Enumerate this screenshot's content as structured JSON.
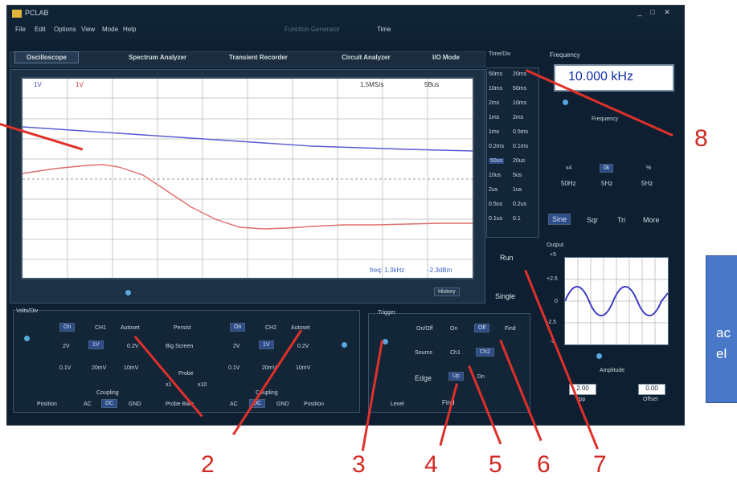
{
  "app": {
    "title": "PCLAB",
    "window_controls": [
      "_",
      "□",
      "✕"
    ],
    "menu": [
      "File",
      "Edit",
      "Options",
      "View",
      "Mode",
      "Help"
    ],
    "menu_right": [
      "Function Generator",
      "Time"
    ]
  },
  "tabs": [
    "Oscilloscope",
    "Spectrum Analyzer",
    "Transient Recorder",
    "Circuit Analyzer",
    "I/O Mode"
  ],
  "scope": {
    "header_left": "1V",
    "header_ch2": "1V",
    "header_rate": "1.5MS/s",
    "header_time": "5Bus",
    "footer_freq": "freq: 1.3kHz",
    "footer_db": "-2.3dBm",
    "history_label": "History",
    "colors": {
      "ch1": "#5a5ad6",
      "ch2": "#e26c6c",
      "grid": "#c9c9c9"
    }
  },
  "timebase": {
    "label": "Time/Div",
    "rows": [
      [
        "50ms",
        "20ms"
      ],
      [
        "10ms",
        "50ms"
      ],
      [
        "2ms",
        "10ms"
      ],
      [
        "1ms",
        "2ms"
      ],
      [
        "1ms",
        "0.5ms"
      ],
      [
        "0.2ms",
        "0.1ms"
      ],
      [
        "50us",
        "20us"
      ],
      [
        "10us",
        "5us"
      ],
      [
        "2us",
        "1us"
      ],
      [
        "0.5us",
        "0.2us"
      ],
      [
        "0.1us",
        "0.1"
      ]
    ],
    "run": "Run",
    "single": "Single"
  },
  "volts": {
    "label": "Volts/Div",
    "ch1": {
      "on": "On",
      "name": "CH1",
      "auto": "Autoset",
      "values": [
        "2V",
        "1V",
        "0.2V",
        "0.1V",
        "20mV",
        "10mV"
      ],
      "coupling": "Coupling",
      "coupling_opts": [
        "AC",
        "DC",
        "GND"
      ],
      "position": "Position"
    },
    "ch2": {
      "on": "On",
      "name": "CH2",
      "auto": "Autoset",
      "values": [
        "2V",
        "1V",
        "0.2V",
        "0.1V",
        "20mV",
        "10mV"
      ],
      "coupling": "Coupling",
      "coupling_opts": [
        "AC",
        "DC",
        "GND"
      ],
      "position": "Position"
    },
    "persist": "Persist",
    "big_screen": "Big Screen",
    "probe": "Probe",
    "probe_opts": [
      "x1",
      "x10"
    ],
    "probe_bath": "Probe Bath"
  },
  "trigger": {
    "label": "Trigger",
    "onoff": "On/Off",
    "on": "On",
    "off": "Off",
    "find": "Find",
    "source": "Source",
    "ch1": "Ch1",
    "ch2": "Ch2",
    "edge": "Edge",
    "up": "Up",
    "dn": "Dn",
    "level": "Level",
    "find2": "Find"
  },
  "generator": {
    "frequency_label": "Frequency",
    "frequency_value": "10.000 kHz",
    "slider_label": "Frequency",
    "steps": [
      "x4",
      "0k",
      "%"
    ],
    "step_vals": [
      "50Hz",
      "5Hz",
      "5Hz"
    ],
    "waves": [
      "Sine",
      "Sqr",
      "Tri",
      "More"
    ],
    "output_label": "Output",
    "y_ticks": [
      "+5",
      "+2.5",
      "0",
      "-2.5",
      "-5"
    ],
    "amplitude_label": "Amplitude",
    "vpp": "2.00",
    "vpp_label": "Vpp",
    "offset": "0.00",
    "offset_label": "Offset"
  },
  "annotations": [
    "2",
    "3",
    "4",
    "5",
    "6",
    "7",
    "8"
  ],
  "side_note": [
    "ac",
    "el"
  ]
}
